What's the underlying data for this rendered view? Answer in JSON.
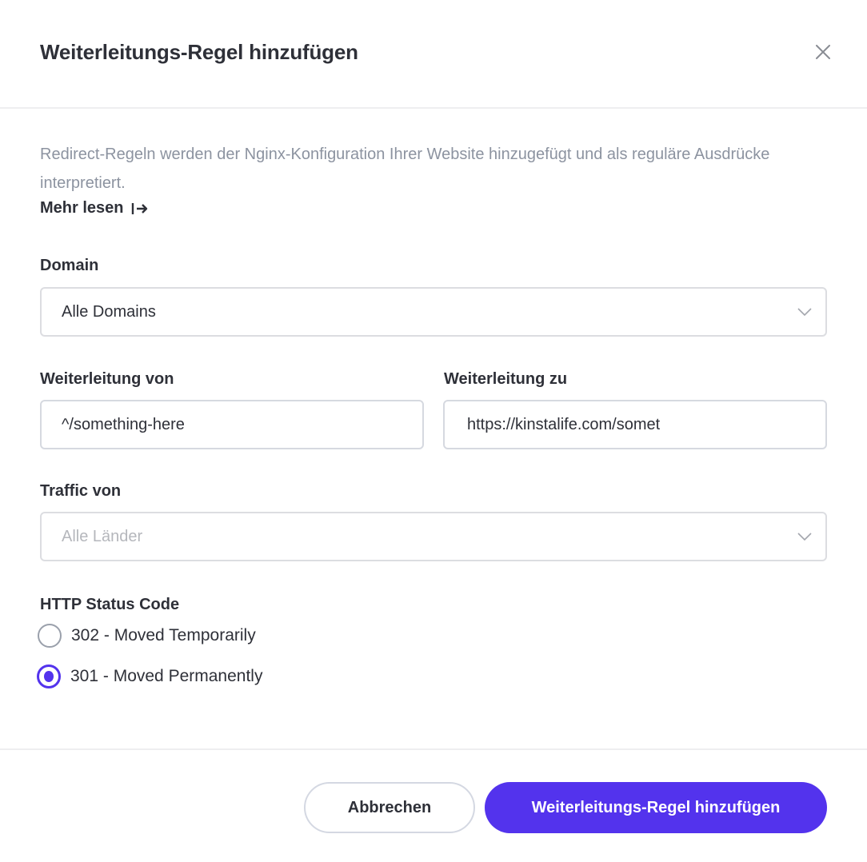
{
  "modal": {
    "title": "Weiterleitungs-Regel hinzufügen",
    "close_icon": "close-icon"
  },
  "intro": {
    "text": "Redirect-Regeln werden der Nginx-Konfiguration Ihrer Website hinzugefügt und als reguläre Ausdrücke interpretiert.",
    "more_link": "Mehr lesen",
    "more_link_icon": "arrow-right-to-bar-icon"
  },
  "form": {
    "domain": {
      "label": "Domain",
      "value": "Alle Domains",
      "icon": "chevron-down-icon"
    },
    "redirect_from": {
      "label": "Weiterleitung von",
      "value": "^/something-here"
    },
    "redirect_to": {
      "label": "Weiterleitung zu",
      "value": "https://kinstalife.com/somet"
    },
    "traffic_from": {
      "label": "Traffic von",
      "placeholder": "Alle Länder",
      "icon": "chevron-down-icon"
    },
    "status_code": {
      "label": "HTTP Status Code",
      "options": [
        {
          "label": "302 - Moved Temporarily",
          "checked": false
        },
        {
          "label": "301 - Moved Permanently",
          "checked": true
        }
      ]
    }
  },
  "footer": {
    "cancel_label": "Abbrechen",
    "submit_label": "Weiterleitungs-Regel hinzufügen"
  },
  "colors": {
    "accent": "#5333ed",
    "text": "#2e3038",
    "muted_text": "#8c93a0",
    "border": "#dcdde1"
  }
}
